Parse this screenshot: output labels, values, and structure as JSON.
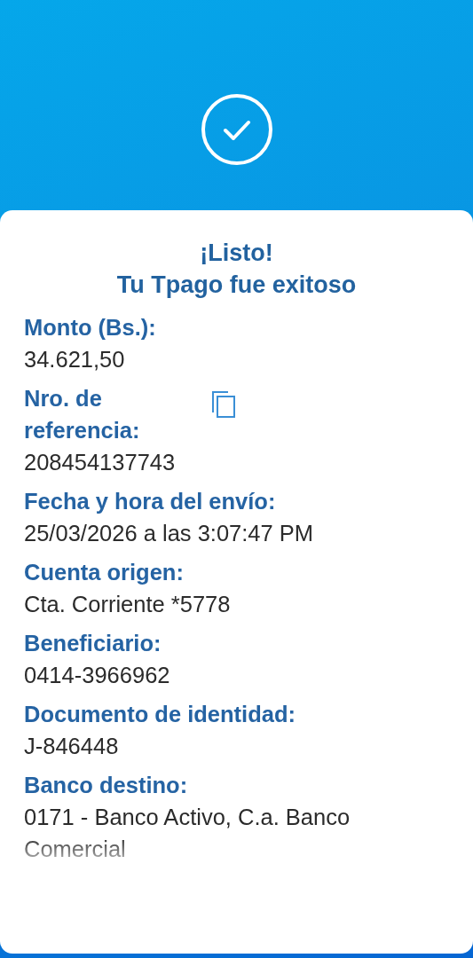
{
  "title": {
    "line_1": "¡Listo!",
    "line_2": "Tu Tpago fue exitoso"
  },
  "fields": [
    {
      "kind": "plain",
      "label": "Monto (Bs.):",
      "value": "34.621,50"
    },
    {
      "kind": "copy",
      "label": "Nro. de referencia:",
      "value": "208454137743"
    },
    {
      "kind": "plain",
      "label": "Fecha y hora del envío:",
      "value": "25/03/2026 a las 3:07:47 PM"
    },
    {
      "kind": "plain",
      "label": "Cuenta origen:",
      "value": "Cta. Corriente *5778"
    },
    {
      "kind": "plain",
      "label": "Beneficiario:",
      "value": "0414-3966962"
    },
    {
      "kind": "plain",
      "label": "Documento de identidad:",
      "value": "J-846448"
    },
    {
      "kind": "plain",
      "label": "Banco destino:",
      "value": "0171 - Banco Activo, C.a. Banco Comercial"
    }
  ]
}
